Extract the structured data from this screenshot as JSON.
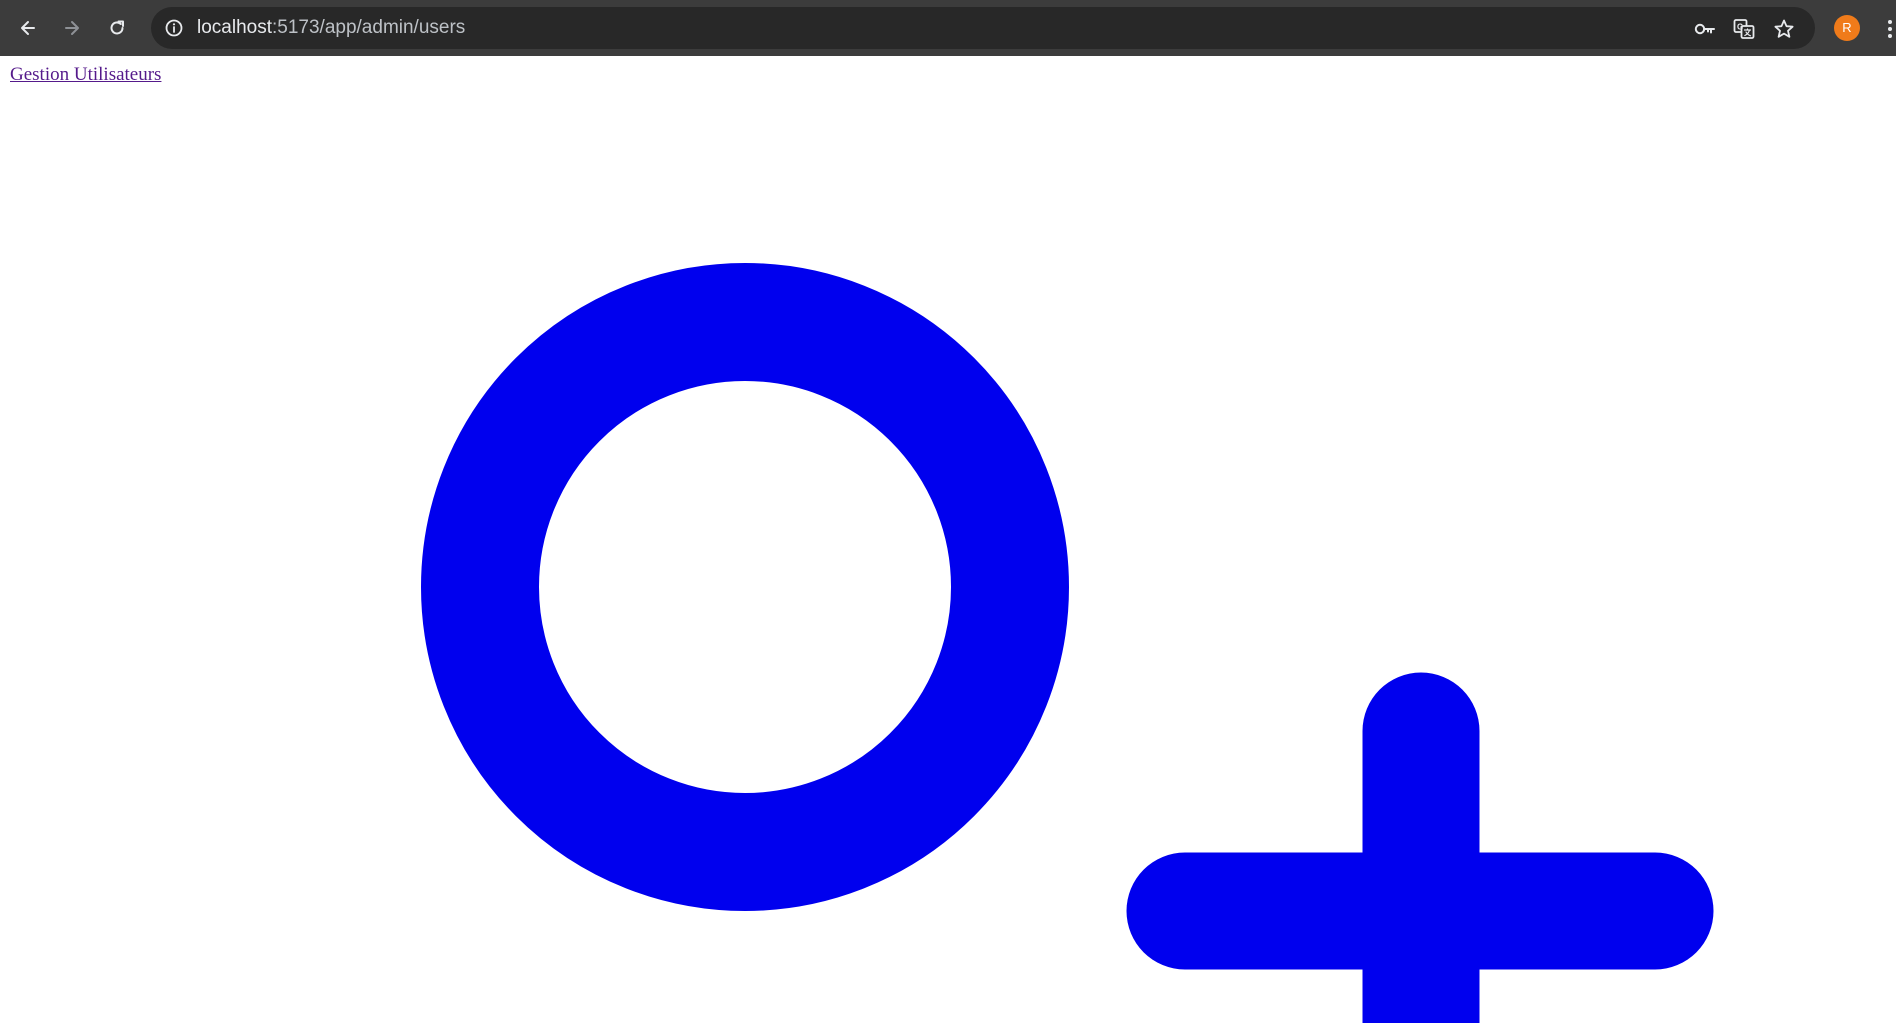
{
  "browser": {
    "url_host": "localhost",
    "url_path": ":5173/app/admin/users",
    "profile_initial": "R",
    "icons": {
      "back": "arrow-left-icon",
      "forward": "arrow-right-icon",
      "reload": "reload-icon",
      "site_info": "info-icon",
      "password": "key-icon",
      "translate": "translate-icon",
      "bookmark": "star-icon",
      "menu": "more-vert-icon"
    }
  },
  "page": {
    "nav_link": "Gestion Utilisateurs",
    "link_color": "#551a8b",
    "icon_color": "#0000ee",
    "big_icon": "add-user-icon"
  }
}
